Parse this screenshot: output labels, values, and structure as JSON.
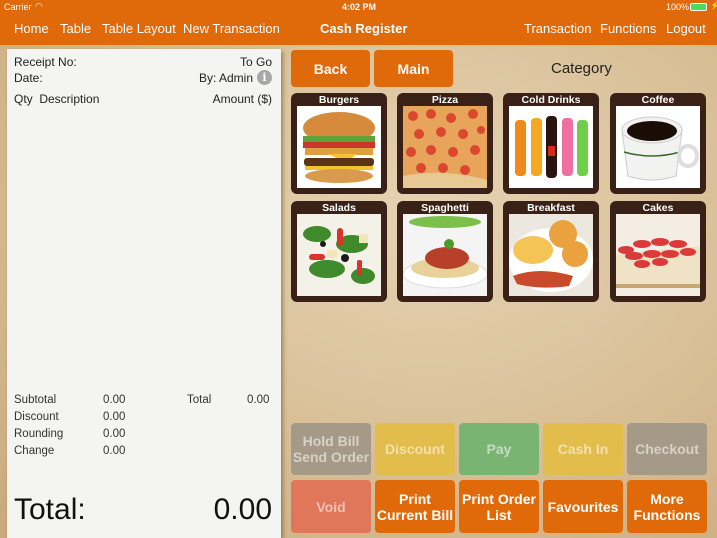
{
  "status_bar": {
    "carrier": "Carrier",
    "time": "4:02 PM",
    "battery": "100%"
  },
  "nav": {
    "left": [
      "Home",
      "Table",
      "Table Layout",
      "New Transaction"
    ],
    "title": "Cash Register",
    "right": [
      "Transaction",
      "Functions",
      "Logout"
    ]
  },
  "receipt": {
    "receipt_no_label": "Receipt No:",
    "order_type": "To Go",
    "date_label": "Date:",
    "by_label": "By: Admin",
    "info_icon": "i",
    "qty_header": "Qty",
    "desc_header": "Description",
    "amount_header": "Amount ($)",
    "summary": [
      {
        "label": "Subtotal",
        "value": "0.00"
      },
      {
        "label": "Discount",
        "value": "0.00"
      },
      {
        "label": "Rounding",
        "value": "0.00"
      },
      {
        "label": "Change",
        "value": "0.00"
      }
    ],
    "total_small_label": "Total",
    "total_small_value": "0.00",
    "total_label": "Total:",
    "total_value": "0.00"
  },
  "category_header": {
    "back": "Back",
    "main": "Main",
    "title": "Category"
  },
  "categories": [
    {
      "label": "Burgers",
      "icon": "burger-image"
    },
    {
      "label": "Pizza",
      "icon": "pizza-image"
    },
    {
      "label": "Cold Drinks",
      "icon": "cold-drinks-image"
    },
    {
      "label": "Coffee",
      "icon": "coffee-image"
    },
    {
      "label": "Salads",
      "icon": "salad-image"
    },
    {
      "label": "Spaghetti",
      "icon": "spaghetti-image"
    },
    {
      "label": "Breakfast",
      "icon": "breakfast-image"
    },
    {
      "label": "Cakes",
      "icon": "cake-image"
    }
  ],
  "actions": {
    "row1": [
      {
        "label": "Hold Bill\nSend Order",
        "color": "#a59a88",
        "enabled": false
      },
      {
        "label": "Discount",
        "color": "#e3bd4c",
        "enabled": false
      },
      {
        "label": "Pay",
        "color": "#79b472",
        "enabled": false
      },
      {
        "label": "Cash In",
        "color": "#e3bd4c",
        "enabled": false
      },
      {
        "label": "Checkout",
        "color": "#a59a88",
        "enabled": false
      }
    ],
    "row2": [
      {
        "label": "Void",
        "color": "#e0775a",
        "enabled": false
      },
      {
        "label": "Print\nCurrent Bill",
        "color": "#e0690a",
        "enabled": true
      },
      {
        "label": "Print Order\nList",
        "color": "#e0690a",
        "enabled": true
      },
      {
        "label": "Favourites",
        "color": "#e0690a",
        "enabled": true
      },
      {
        "label": "More\nFunctions",
        "color": "#e0690a",
        "enabled": true
      }
    ]
  },
  "colors": {
    "accent": "#e0690a",
    "tile_frame": "#3a2117"
  }
}
